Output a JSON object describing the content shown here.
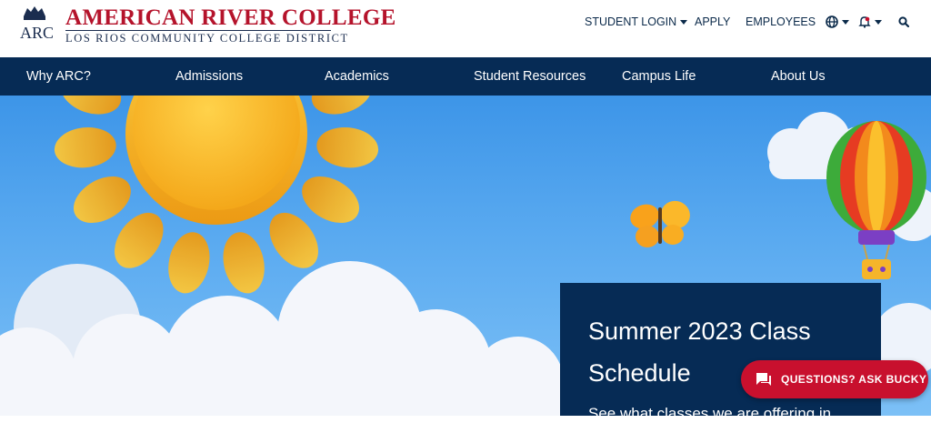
{
  "header": {
    "college_name": "AMERICAN RIVER COLLEGE",
    "district_name": "LOS RIOS COMMUNITY COLLEGE DISTRICT",
    "logo_text": "ARC",
    "utility_links": {
      "student_login": "STUDENT LOGIN",
      "apply": "APPLY",
      "employees": "EMPLOYEES"
    },
    "icons": {
      "language": "globe-icon",
      "alerts": "bell-icon",
      "search": "search-icon"
    }
  },
  "nav": {
    "items": [
      {
        "label": "Why ARC?"
      },
      {
        "label": "Admissions"
      },
      {
        "label": "Academics"
      },
      {
        "label": "Student Resources"
      },
      {
        "label": "Campus Life"
      },
      {
        "label": "About Us"
      }
    ]
  },
  "hero": {
    "card_title": "Summer 2023 Class Schedule",
    "card_text": "See what classes we are offering in"
  },
  "chat": {
    "label": "QUESTIONS? ASK BUCKY"
  },
  "colors": {
    "brand_red": "#b5132b",
    "navy": "#062b55",
    "chat_red": "#c8102e",
    "sky": "#5aaaf0"
  }
}
